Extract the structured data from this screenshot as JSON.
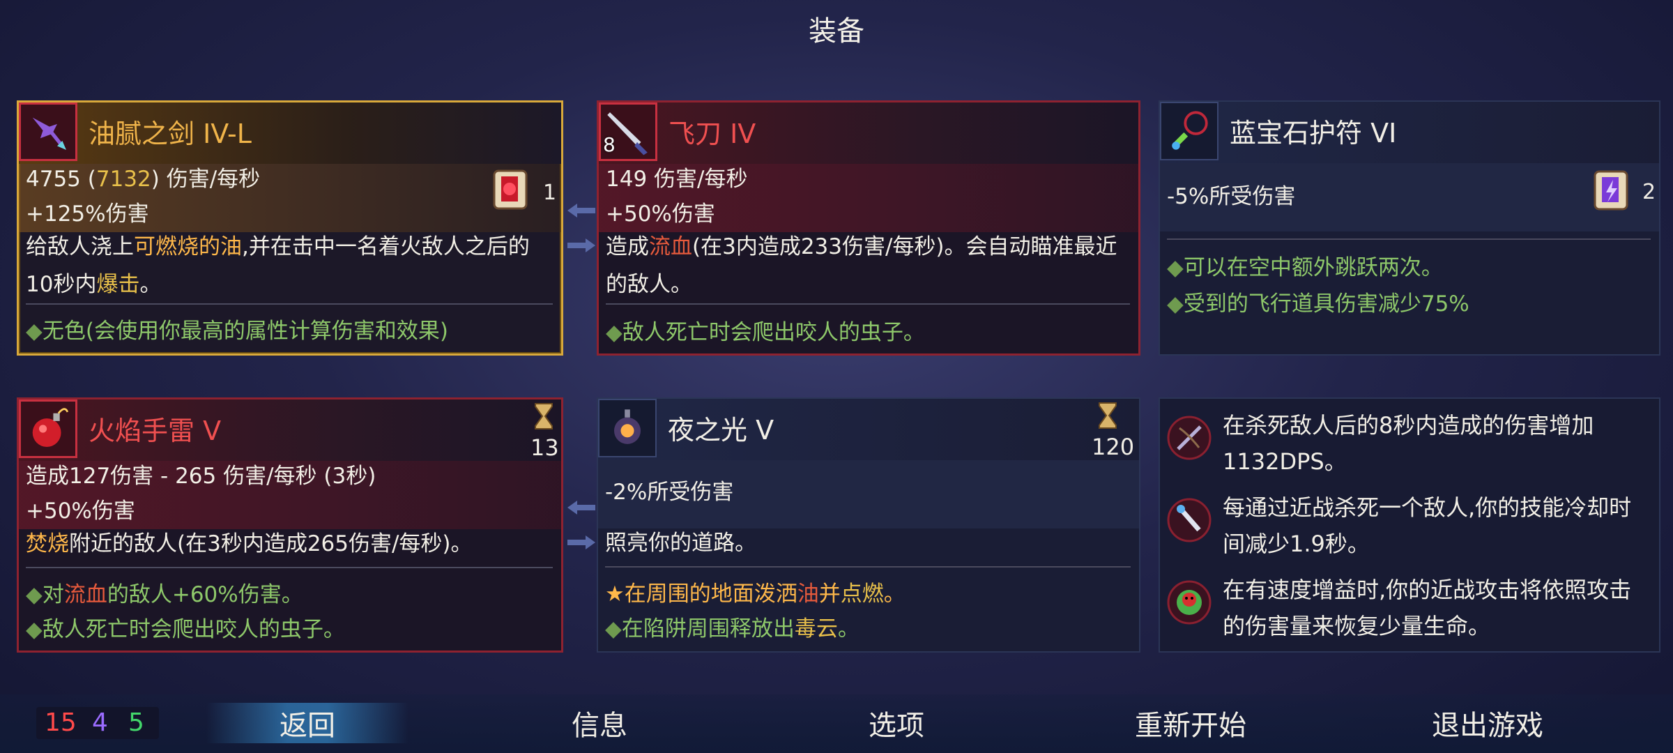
{
  "title": "装备",
  "slots": {
    "weapon1": {
      "name": "油腻之剑 IV-L",
      "icon": "oily-sword-icon",
      "dps_value": "4755",
      "dps_alt": "7132",
      "dps_suffix": "伤害/每秒",
      "bonus": "+125%伤害",
      "scroll_count": "1",
      "desc": {
        "p1": "给敌人浇上",
        "k1": "可燃烧的油",
        "p2": ",并在击中一名着火敌人之后的10秒内",
        "k2": "爆击",
        "p3": "。"
      },
      "feature": "无色(会使用你最高的属性计算伤害和效果)"
    },
    "weapon2": {
      "name": "飞刀 IV",
      "icon": "throwing-knife-icon",
      "level": "8",
      "dps": "149 伤害/每秒",
      "bonus": "+50%伤害",
      "desc": {
        "p1": "造成",
        "k1": "流血",
        "p2": "(在3内造成233伤害/每秒)。会自动瞄准最近的敌人。"
      },
      "feature": "敌人死亡时会爬出咬人的虫子。"
    },
    "amulet": {
      "name": "蓝宝石护符 VI",
      "icon": "sapphire-amulet-icon",
      "stat": "-5%所受伤害",
      "scroll_count": "2",
      "features": [
        "可以在空中额外跳跃两次。",
        "受到的飞行道具伤害减少75%"
      ]
    },
    "skill1": {
      "name": "火焰手雷 V",
      "icon": "fire-grenade-icon",
      "cooldown": "13",
      "dmg": "造成127伤害 - 265 伤害/每秒 (3秒)",
      "bonus": "+50%伤害",
      "desc": {
        "k1": "焚烧",
        "p1": "附近的敌人(在3秒内造成265伤害/每秒)。"
      },
      "feature1": {
        "p1": "对",
        "k1": "流血",
        "p2": "的敌人+60%伤害。"
      },
      "feature2": "敌人死亡时会爬出咬人的虫子。"
    },
    "skill2": {
      "name": "夜之光 V",
      "icon": "night-light-icon",
      "cooldown": "120",
      "stat": "-2%所受伤害",
      "desc": "照亮你的道路。",
      "feature1": {
        "p1": "在周围的地面泼洒",
        "k1": "油",
        "p2": "并",
        "k2": "点燃",
        "p3": "。"
      },
      "feature2": {
        "p1": "在陷阱周围释放出",
        "k1": "毒云",
        "p2": "。"
      }
    }
  },
  "mutations": [
    {
      "icon": "bow-kill-mutation-icon",
      "text": "在杀死敌人后的8秒内造成的伤害增加1132DPS。"
    },
    {
      "icon": "melee-kill-mutation-icon",
      "text": "每通过近战杀死一个敌人,你的技能冷却时间减少1.9秒。"
    },
    {
      "icon": "skull-mutation-icon",
      "text": "在有速度增益时,你的近战攻击将依照攻击的伤害量来恢复少量生命。"
    }
  ],
  "stats": {
    "brutality": "15",
    "tactics": "4",
    "survival": "5",
    "colors": [
      "#ff4a4a",
      "#9a6cff",
      "#43d66a"
    ]
  },
  "nav": {
    "back": "返回",
    "info": "信息",
    "options": "选项",
    "restart": "重新开始",
    "quit": "退出游戏"
  }
}
